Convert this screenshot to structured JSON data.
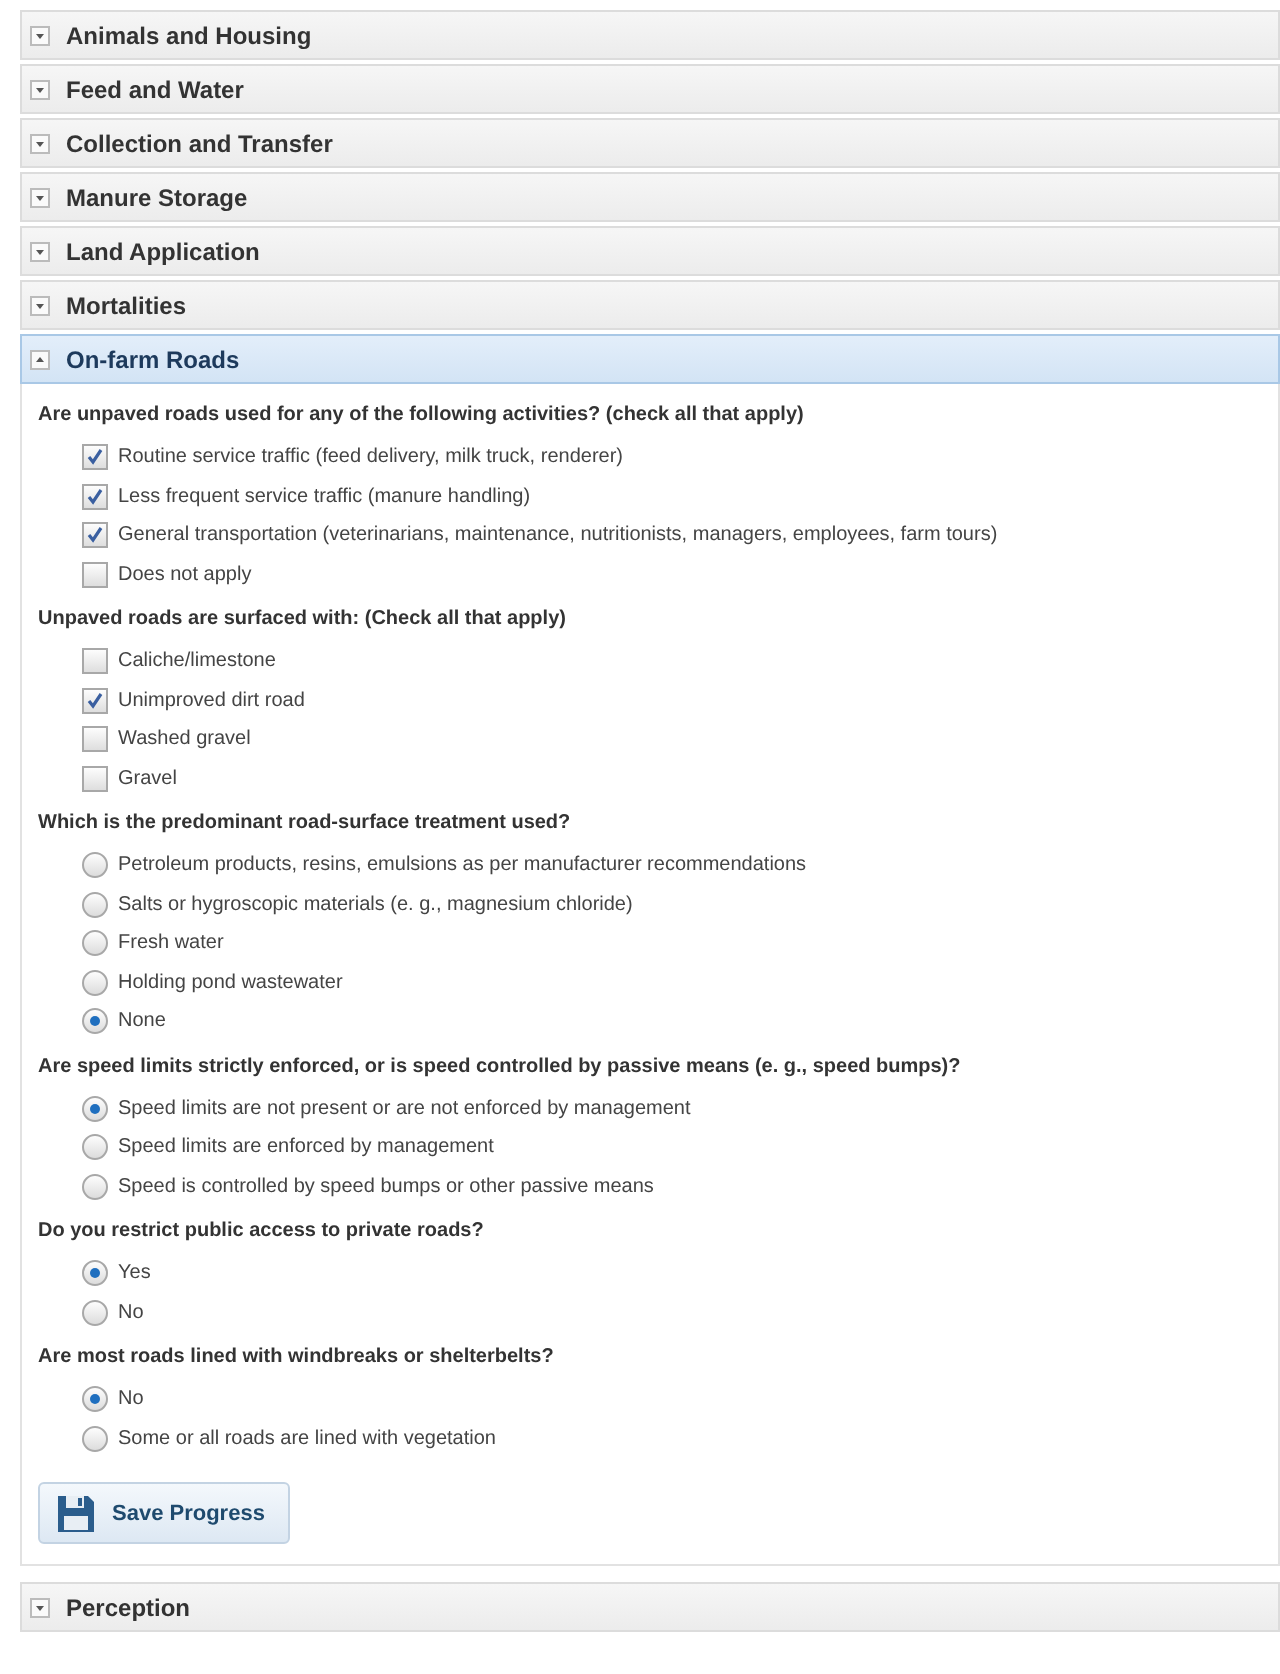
{
  "sections": [
    {
      "title": "Animals and Housing",
      "expanded": false
    },
    {
      "title": "Feed and Water",
      "expanded": false
    },
    {
      "title": "Collection and Transfer",
      "expanded": false
    },
    {
      "title": "Manure Storage",
      "expanded": false
    },
    {
      "title": "Land Application",
      "expanded": false
    },
    {
      "title": "Mortalities",
      "expanded": false
    },
    {
      "title": "On-farm Roads",
      "expanded": true,
      "questions": [
        {
          "kind": "checkbox",
          "text": "Are unpaved roads used for any of the following activities? (check all that apply)",
          "options": [
            {
              "label": "Routine service traffic (feed delivery, milk truck, renderer)",
              "checked": true
            },
            {
              "label": "Less frequent service traffic (manure handling)",
              "checked": true
            },
            {
              "label": "General transportation (veterinarians, maintenance, nutritionists, managers, employees, farm tours)",
              "checked": true
            },
            {
              "label": "Does not apply",
              "checked": false
            }
          ]
        },
        {
          "kind": "checkbox",
          "text": "Unpaved roads are surfaced with: (Check all that apply)",
          "options": [
            {
              "label": "Caliche/limestone",
              "checked": false
            },
            {
              "label": "Unimproved dirt road",
              "checked": true
            },
            {
              "label": "Washed gravel",
              "checked": false
            },
            {
              "label": "Gravel",
              "checked": false
            }
          ]
        },
        {
          "kind": "radio",
          "text": "Which is the predominant road-surface treatment used?",
          "options": [
            {
              "label": "Petroleum products, resins, emulsions as per manufacturer recommendations",
              "selected": false
            },
            {
              "label": "Salts or hygroscopic materials (e. g., magnesium chloride)",
              "selected": false
            },
            {
              "label": "Fresh water",
              "selected": false
            },
            {
              "label": "Holding pond wastewater",
              "selected": false
            },
            {
              "label": "None",
              "selected": true
            }
          ]
        },
        {
          "kind": "radio",
          "text": "Are speed limits strictly enforced, or is speed controlled by passive means (e. g., speed bumps)?",
          "options": [
            {
              "label": "Speed limits are not present or are not enforced by management",
              "selected": true
            },
            {
              "label": "Speed limits are enforced by management",
              "selected": false
            },
            {
              "label": "Speed is controlled by speed bumps or other passive means",
              "selected": false
            }
          ]
        },
        {
          "kind": "radio",
          "text": "Do you restrict public access to private roads?",
          "options": [
            {
              "label": "Yes",
              "selected": true
            },
            {
              "label": "No",
              "selected": false
            }
          ]
        },
        {
          "kind": "radio",
          "text": "Are most roads lined with windbreaks or shelterbelts?",
          "options": [
            {
              "label": "No",
              "selected": true
            },
            {
              "label": "Some or all roads are lined with vegetation",
              "selected": false
            }
          ]
        }
      ],
      "save_button": "Save Progress"
    },
    {
      "title": "Perception",
      "expanded": false
    }
  ]
}
